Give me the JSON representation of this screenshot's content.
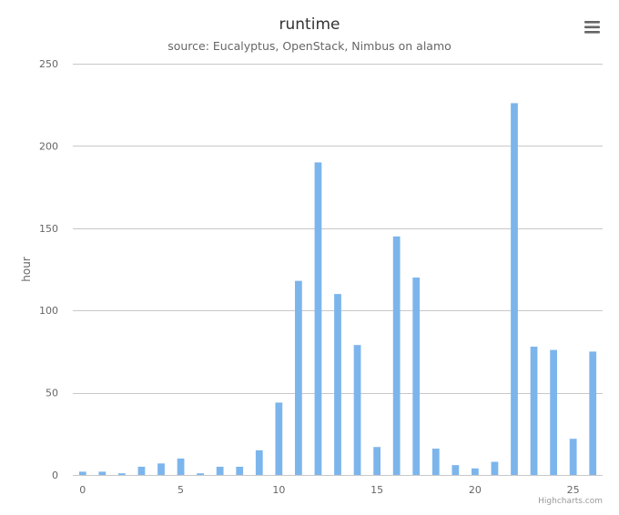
{
  "chart_data": {
    "type": "bar",
    "title": "runtime",
    "subtitle": "source: Eucalyptus, OpenStack, Nimbus on alamo",
    "ylabel": "hour",
    "xlabel": "",
    "x": [
      0,
      1,
      2,
      3,
      4,
      5,
      6,
      7,
      8,
      9,
      10,
      11,
      12,
      13,
      14,
      15,
      16,
      17,
      18,
      19,
      20,
      21,
      22,
      23,
      24,
      25,
      26
    ],
    "values": [
      2,
      2,
      1,
      5,
      7,
      10,
      1,
      5,
      5,
      15,
      44,
      118,
      190,
      110,
      79,
      17,
      145,
      120,
      16,
      6,
      4,
      8,
      226,
      78,
      76,
      22,
      75
    ],
    "xlim": [
      -0.5,
      26.5
    ],
    "ylim": [
      0,
      250
    ],
    "x_ticks": [
      0,
      5,
      10,
      15,
      20,
      25
    ],
    "y_ticks": [
      0,
      50,
      100,
      150,
      200,
      250
    ],
    "grid": true,
    "bar_color": "#7cb5ec",
    "legend": "none"
  },
  "credits": "Highcharts.com",
  "menu_icon": "hamburger-menu-icon"
}
